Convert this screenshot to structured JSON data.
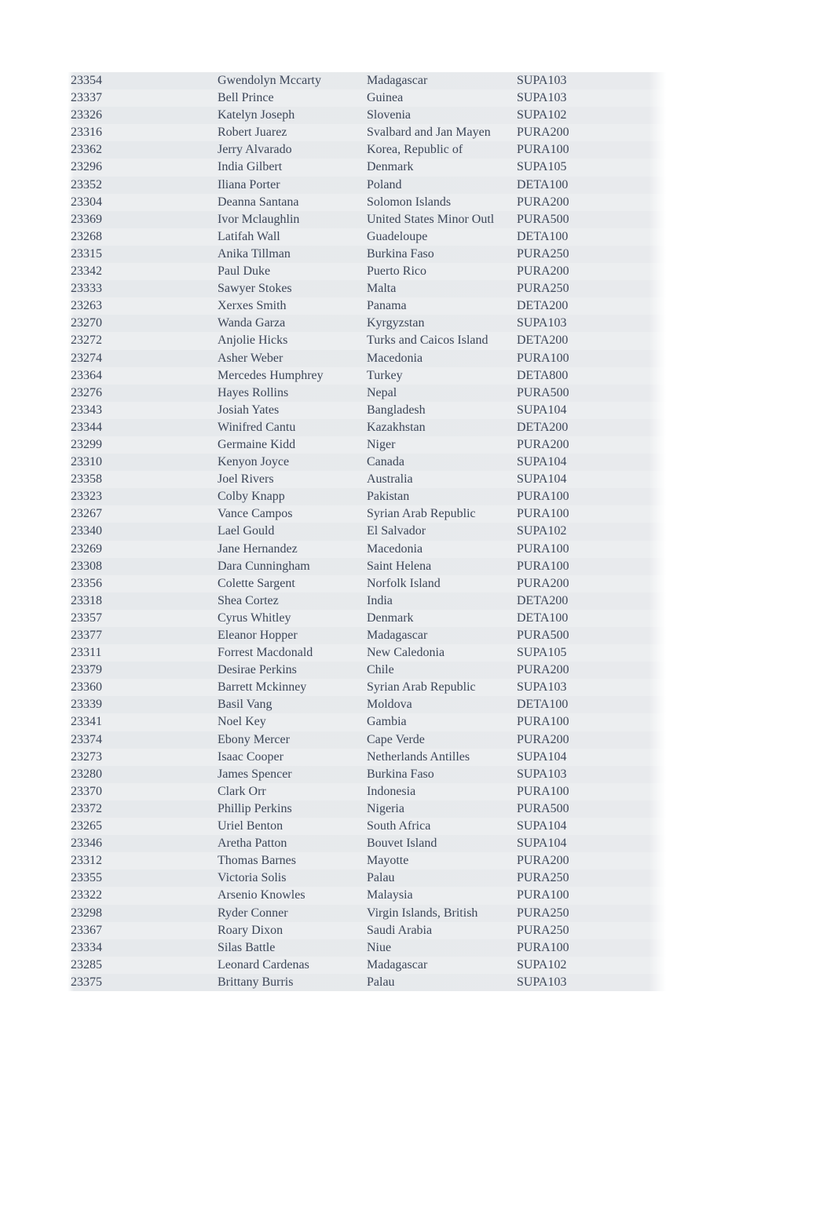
{
  "table": {
    "rows": [
      {
        "id": "23354",
        "name": "Gwendolyn Mccarty",
        "country": "Madagascar",
        "code": "SUPA103"
      },
      {
        "id": "23337",
        "name": "Bell Prince",
        "country": "Guinea",
        "code": "SUPA103"
      },
      {
        "id": "23326",
        "name": "Katelyn Joseph",
        "country": "Slovenia",
        "code": "SUPA102"
      },
      {
        "id": "23316",
        "name": "Robert Juarez",
        "country": "Svalbard and Jan Mayen",
        "code": "PURA200"
      },
      {
        "id": "23362",
        "name": "Jerry Alvarado",
        "country": "Korea, Republic of",
        "code": "PURA100"
      },
      {
        "id": "23296",
        "name": "India Gilbert",
        "country": "Denmark",
        "code": "SUPA105"
      },
      {
        "id": "23352",
        "name": "Iliana Porter",
        "country": "Poland",
        "code": "DETA100"
      },
      {
        "id": "23304",
        "name": "Deanna Santana",
        "country": "Solomon Islands",
        "code": "PURA200"
      },
      {
        "id": "23369",
        "name": "Ivor Mclaughlin",
        "country": "United States Minor Outl",
        "code": "PURA500"
      },
      {
        "id": "23268",
        "name": "Latifah Wall",
        "country": "Guadeloupe",
        "code": "DETA100"
      },
      {
        "id": "23315",
        "name": "Anika Tillman",
        "country": "Burkina Faso",
        "code": "PURA250"
      },
      {
        "id": "23342",
        "name": "Paul Duke",
        "country": "Puerto Rico",
        "code": "PURA200"
      },
      {
        "id": "23333",
        "name": "Sawyer Stokes",
        "country": "Malta",
        "code": "PURA250"
      },
      {
        "id": "23263",
        "name": "Xerxes Smith",
        "country": "Panama",
        "code": "DETA200"
      },
      {
        "id": "23270",
        "name": "Wanda Garza",
        "country": "Kyrgyzstan",
        "code": "SUPA103"
      },
      {
        "id": "23272",
        "name": "Anjolie Hicks",
        "country": "Turks and Caicos Island",
        "code": "DETA200"
      },
      {
        "id": "23274",
        "name": "Asher Weber",
        "country": "Macedonia",
        "code": "PURA100"
      },
      {
        "id": "23364",
        "name": "Mercedes Humphrey",
        "country": "Turkey",
        "code": "DETA800"
      },
      {
        "id": "23276",
        "name": "Hayes Rollins",
        "country": "Nepal",
        "code": "PURA500"
      },
      {
        "id": "23343",
        "name": "Josiah Yates",
        "country": "Bangladesh",
        "code": "SUPA104"
      },
      {
        "id": "23344",
        "name": "Winifred Cantu",
        "country": "Kazakhstan",
        "code": "DETA200"
      },
      {
        "id": "23299",
        "name": "Germaine Kidd",
        "country": "Niger",
        "code": "PURA200"
      },
      {
        "id": "23310",
        "name": "Kenyon Joyce",
        "country": "Canada",
        "code": "SUPA104"
      },
      {
        "id": "23358",
        "name": "Joel Rivers",
        "country": "Australia",
        "code": "SUPA104"
      },
      {
        "id": "23323",
        "name": "Colby Knapp",
        "country": "Pakistan",
        "code": "PURA100"
      },
      {
        "id": "23267",
        "name": "Vance Campos",
        "country": "Syrian Arab Republic",
        "code": "PURA100"
      },
      {
        "id": "23340",
        "name": "Lael Gould",
        "country": "El Salvador",
        "code": "SUPA102"
      },
      {
        "id": "23269",
        "name": "Jane Hernandez",
        "country": "Macedonia",
        "code": "PURA100"
      },
      {
        "id": "23308",
        "name": "Dara Cunningham",
        "country": "Saint Helena",
        "code": "PURA100"
      },
      {
        "id": "23356",
        "name": "Colette Sargent",
        "country": "Norfolk Island",
        "code": "PURA200"
      },
      {
        "id": "23318",
        "name": "Shea Cortez",
        "country": "India",
        "code": "DETA200"
      },
      {
        "id": "23357",
        "name": "Cyrus Whitley",
        "country": "Denmark",
        "code": "DETA100"
      },
      {
        "id": "23377",
        "name": "Eleanor Hopper",
        "country": "Madagascar",
        "code": "PURA500"
      },
      {
        "id": "23311",
        "name": "Forrest Macdonald",
        "country": "New Caledonia",
        "code": "SUPA105"
      },
      {
        "id": "23379",
        "name": "Desirae Perkins",
        "country": "Chile",
        "code": "PURA200"
      },
      {
        "id": "23360",
        "name": "Barrett Mckinney",
        "country": "Syrian Arab Republic",
        "code": "SUPA103"
      },
      {
        "id": "23339",
        "name": "Basil Vang",
        "country": "Moldova",
        "code": "DETA100"
      },
      {
        "id": "23341",
        "name": "Noel Key",
        "country": "Gambia",
        "code": "PURA100"
      },
      {
        "id": "23374",
        "name": "Ebony Mercer",
        "country": "Cape Verde",
        "code": "PURA200"
      },
      {
        "id": "23273",
        "name": "Isaac Cooper",
        "country": "Netherlands Antilles",
        "code": "SUPA104"
      },
      {
        "id": "23280",
        "name": "James Spencer",
        "country": "Burkina Faso",
        "code": "SUPA103"
      },
      {
        "id": "23370",
        "name": "Clark Orr",
        "country": "Indonesia",
        "code": "PURA100"
      },
      {
        "id": "23372",
        "name": "Phillip Perkins",
        "country": "Nigeria",
        "code": "PURA500"
      },
      {
        "id": "23265",
        "name": "Uriel Benton",
        "country": "South Africa",
        "code": "SUPA104"
      },
      {
        "id": "23346",
        "name": "Aretha Patton",
        "country": "Bouvet Island",
        "code": "SUPA104"
      },
      {
        "id": "23312",
        "name": "Thomas Barnes",
        "country": "Mayotte",
        "code": "PURA200"
      },
      {
        "id": "23355",
        "name": "Victoria Solis",
        "country": "Palau",
        "code": "PURA250"
      },
      {
        "id": "23322",
        "name": "Arsenio Knowles",
        "country": "Malaysia",
        "code": "PURA100"
      },
      {
        "id": "23298",
        "name": "Ryder Conner",
        "country": "Virgin Islands, British",
        "code": "PURA250"
      },
      {
        "id": "23367",
        "name": "Roary Dixon",
        "country": "Saudi Arabia",
        "code": "PURA250"
      },
      {
        "id": "23334",
        "name": "Silas Battle",
        "country": "Niue",
        "code": "PURA100"
      },
      {
        "id": "23285",
        "name": "Leonard Cardenas",
        "country": "Madagascar",
        "code": "SUPA102"
      },
      {
        "id": "23375",
        "name": "Brittany Burris",
        "country": "Palau",
        "code": "SUPA103"
      }
    ]
  }
}
